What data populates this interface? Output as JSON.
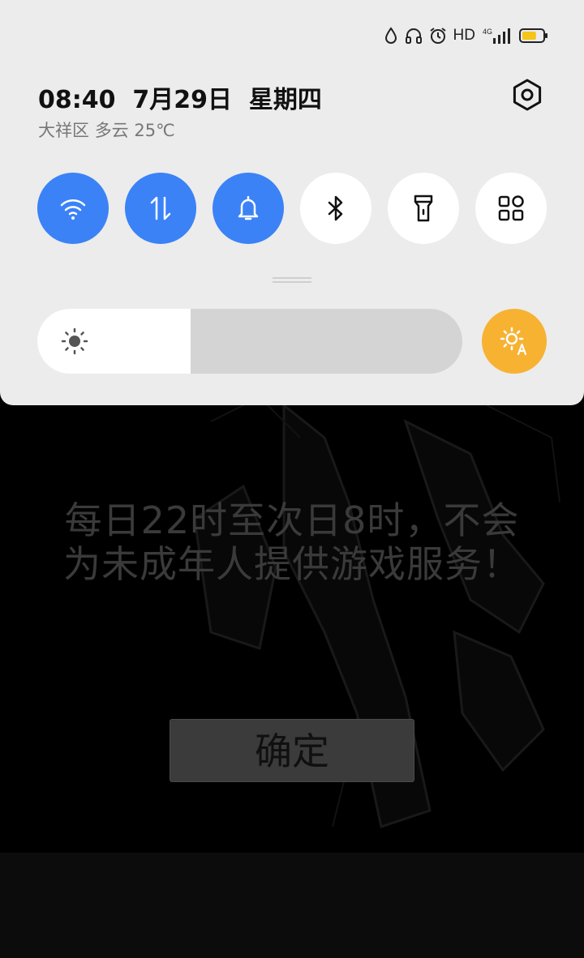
{
  "status_bar": {
    "network_type": "HD",
    "signal_label": "4G",
    "icons": [
      "water-drop-icon",
      "headset-icon",
      "alarm-icon",
      "hd-icon",
      "signal-4g-icon",
      "battery-icon"
    ],
    "battery_fill_fraction": 0.7,
    "battery_color": "#f5c518"
  },
  "quick_panel": {
    "time": "08:40",
    "date": "7月29日",
    "weekday": "星期四",
    "location": "大祥区",
    "weather": "多云",
    "temperature": "25℃",
    "toggles": [
      {
        "icon": "wifi-icon",
        "state": "on"
      },
      {
        "icon": "mobile-data-icon",
        "state": "on"
      },
      {
        "icon": "bell-icon",
        "state": "on"
      },
      {
        "icon": "bluetooth-icon",
        "state": "off"
      },
      {
        "icon": "flashlight-icon",
        "state": "off"
      },
      {
        "icon": "grid-apps-icon",
        "state": "off"
      }
    ],
    "brightness_fraction": 0.36,
    "accent_color": "#3b82f6",
    "auto_brightness_color": "#f7b232"
  },
  "game": {
    "notice_line1": "每日22时至次日8时，不会",
    "notice_line2": "为未成年人提供游戏服务！",
    "confirm_label": "确定"
  }
}
